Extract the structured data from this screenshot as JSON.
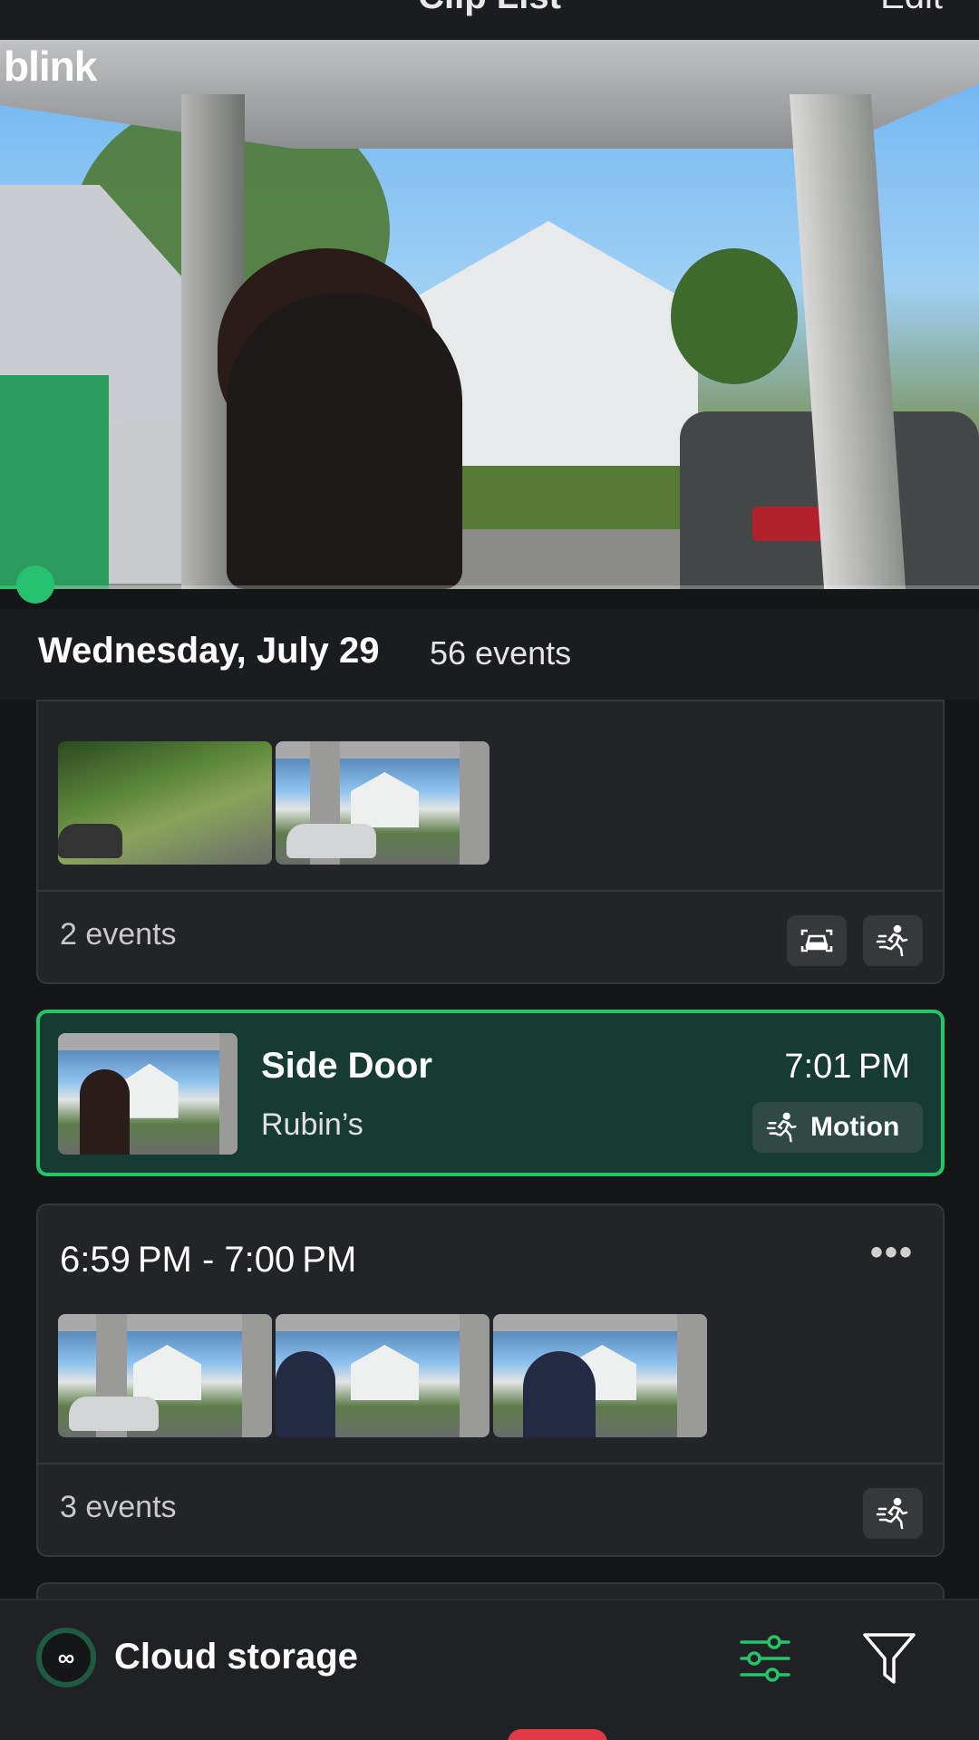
{
  "header": {
    "title": "Clip List",
    "edit_label": "Edit"
  },
  "player": {
    "brand": "blink",
    "playback_progress": 0.03
  },
  "date_group": {
    "day": "Wednesday, July 29",
    "count": "56 events"
  },
  "cards": [
    {
      "type": "group",
      "events_label": "2 events",
      "thumbnails": 2,
      "tags": [
        "vehicle-icon",
        "motion-icon"
      ]
    },
    {
      "type": "clip",
      "camera": "Side Door",
      "site": "Rubin’s",
      "time": "7:01 PM",
      "tag_label": "Motion",
      "tag_icon": "motion-icon",
      "selected": true
    },
    {
      "type": "group",
      "time_range": "6:59 PM - 7:00 PM",
      "events_label": "3 events",
      "thumbnails": 3,
      "tags": [
        "motion-icon"
      ],
      "menu": "•••"
    }
  ],
  "bottom_bar": {
    "storage_icon": "∞",
    "storage_label": "Cloud storage",
    "icons": [
      "sliders-icon",
      "funnel-icon"
    ]
  },
  "colors": {
    "accent": "#22c56a",
    "selected_bg": "#163b32",
    "card_bg": "#232427",
    "background": "#151618"
  }
}
